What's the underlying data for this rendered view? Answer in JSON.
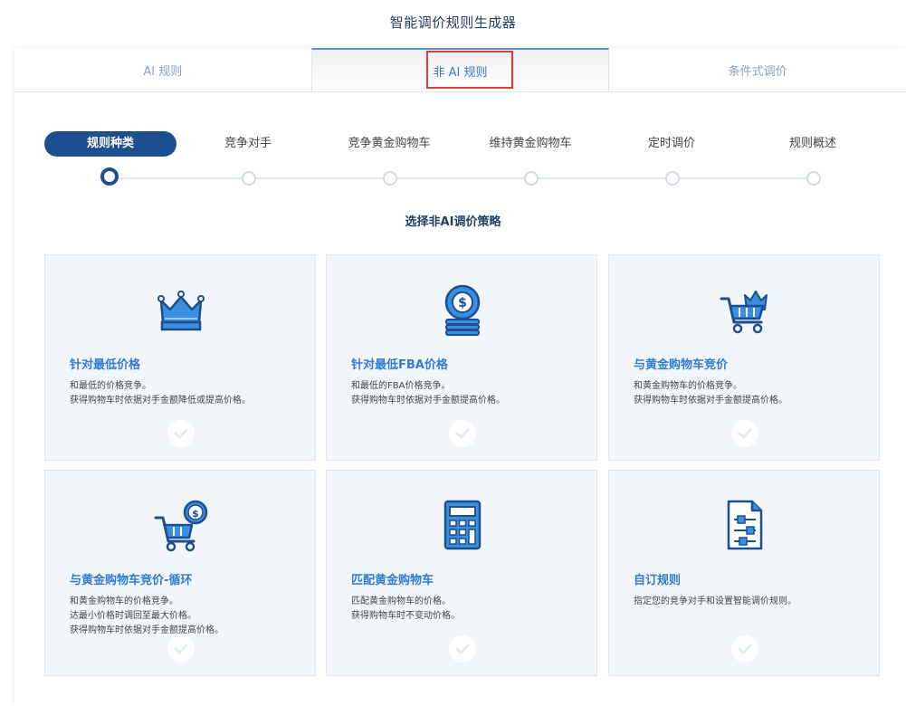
{
  "page_title": "智能调价规则生成器",
  "tabs": [
    {
      "label": "AI 规则",
      "active": false
    },
    {
      "label": "非 AI 规则",
      "active": true
    },
    {
      "label": "条件式调价",
      "active": false
    }
  ],
  "steps": [
    {
      "label": "规则种类",
      "active": true
    },
    {
      "label": "竞争对手",
      "active": false
    },
    {
      "label": "竞争黄金购物车",
      "active": false
    },
    {
      "label": "维持黄金购物车",
      "active": false
    },
    {
      "label": "定时调价",
      "active": false
    },
    {
      "label": "规则概述",
      "active": false
    }
  ],
  "subtitle": "选择非AI调价策略",
  "colors": {
    "primary_dark": "#1b4f90",
    "accent_blue": "#2f7cd0",
    "highlight_red": "#e03a3a",
    "card_bg": "#f2f6fa"
  },
  "cards": [
    {
      "icon": "crown-icon",
      "title": "针对最低价格",
      "desc": [
        "和最低的价格竞争。",
        "获得购物车时依据对手金额降低或提高价格。"
      ]
    },
    {
      "icon": "dollar-coin-icon",
      "title": "针对最低FBA价格",
      "desc": [
        "和最低的FBA价格竞争。",
        "获得购物车时依据对手金额提高价格。"
      ]
    },
    {
      "icon": "crown-cart-icon",
      "title": "与黄金购物车竞价",
      "desc": [
        "和黄金购物车的价格竞争。",
        "获得购物车时依据对手金额提高价格。"
      ]
    },
    {
      "icon": "cart-dollar-icon",
      "title": "与黄金购物车竞价-循环",
      "desc": [
        "和黄金购物车的价格竞争。",
        "达最小价格时调回至最大价格。",
        "获得购物车时依据对手金额提高价格。"
      ]
    },
    {
      "icon": "calculator-icon",
      "title": "匹配黄金购物车",
      "desc": [
        "匹配黄金购物车的价格。",
        "获得购物车时不变动价格。"
      ]
    },
    {
      "icon": "document-settings-icon",
      "title": "自订规则",
      "desc": [
        "指定您的竞争对手和设置智能调价规则。"
      ]
    }
  ]
}
